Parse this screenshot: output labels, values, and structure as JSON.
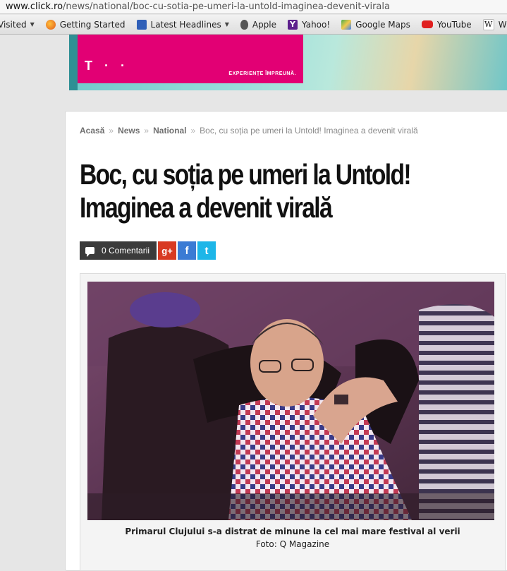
{
  "browser": {
    "url_host": "www.click.ro",
    "url_path": "/news/national/boc-cu-sotia-pe-umeri-la-untold-imaginea-devenit-virala",
    "bookmarks": [
      {
        "label": "Visited",
        "icon": "folder-icon",
        "dropdown": true
      },
      {
        "label": "Getting Started",
        "icon": "firefox-icon",
        "dropdown": false
      },
      {
        "label": "Latest Headlines",
        "icon": "rss-icon",
        "dropdown": true
      },
      {
        "label": "Apple",
        "icon": "apple-icon",
        "dropdown": false
      },
      {
        "label": "Yahoo!",
        "icon": "yahoo-icon",
        "dropdown": false
      },
      {
        "label": "Google Maps",
        "icon": "maps-icon",
        "dropdown": false
      },
      {
        "label": "YouTube",
        "icon": "youtube-icon",
        "dropdown": false
      },
      {
        "label": "Wikipedia",
        "icon": "wikipedia-icon",
        "dropdown": false
      }
    ]
  },
  "ad": {
    "logo": "T · ·",
    "slogan": "EXPERIENȚE ÎMPREUNĂ.",
    "brand_color": "#e20074"
  },
  "breadcrumb": {
    "home": "Acasă",
    "section": "News",
    "subsection": "National",
    "current": "Boc, cu soția pe umeri la Untold! Imaginea a devenit virală"
  },
  "article": {
    "title_line1": "Boc, cu soția pe umeri la Untold!",
    "title_line2": "Imaginea a devenit virală",
    "comments_label": "0 Comentarii",
    "share": {
      "gplus": "g+",
      "facebook": "f",
      "twitter": "t"
    },
    "photo_caption": "Primarul Clujului s-a distrat de minune la cel mai mare festival al verii",
    "photo_credit": "Foto: Q Magazine"
  }
}
